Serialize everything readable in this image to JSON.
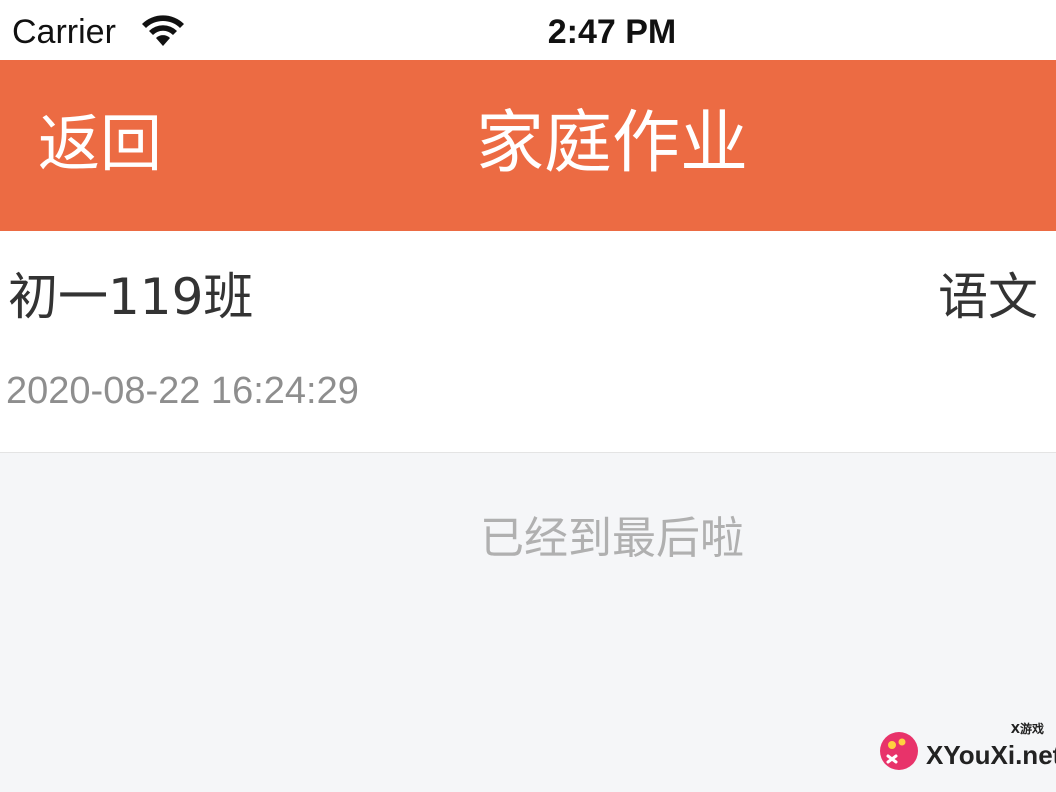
{
  "status_bar": {
    "carrier": "Carrier",
    "time": "2:47 PM",
    "wifi_icon": "wifi-icon"
  },
  "nav": {
    "back_label": "返回",
    "title": "家庭作业",
    "background_color": "#ec6b43"
  },
  "homework": {
    "class_name": "初一119班",
    "subject": "语文",
    "timestamp": "2020-08-22 16:24:29"
  },
  "list_end_text": "已经到最后啦",
  "watermark": {
    "text": "XYouXi.net",
    "small_text": "X游戏"
  }
}
